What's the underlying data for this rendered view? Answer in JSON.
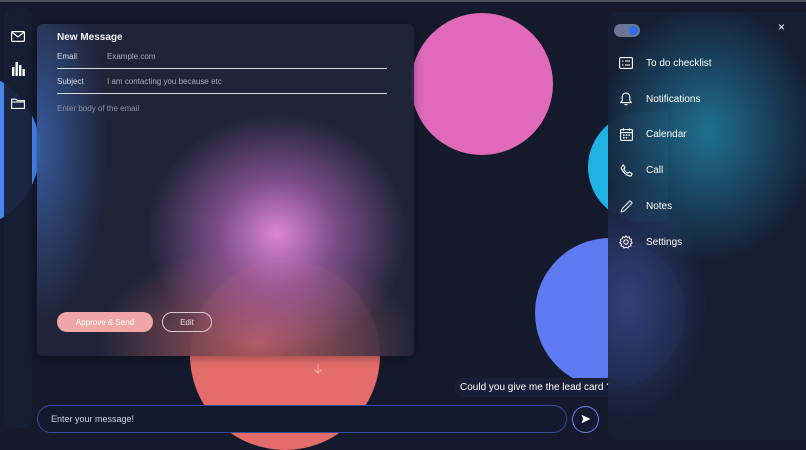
{
  "compose": {
    "title": "New Message",
    "email_label": "Email",
    "email_value": "Example.com",
    "subject_label": "Subject",
    "subject_value": "I am contacting you because etc",
    "body_placeholder": "Enter body of the email",
    "approve_label": "Approve & Send",
    "edit_label": "Edit"
  },
  "rail": {
    "icons": [
      "mail-icon",
      "bar-chart-icon",
      "folder-icon"
    ]
  },
  "chat": {
    "message": "Could you give me the lead card ?",
    "input_placeholder": "Enter your message!"
  },
  "panel": {
    "close_label": "×",
    "items": [
      {
        "label": "To do checklist",
        "icon": "checklist-icon"
      },
      {
        "label": "Notifications",
        "icon": "bell-icon"
      },
      {
        "label": "Calendar",
        "icon": "calendar-icon"
      },
      {
        "label": "Call",
        "icon": "phone-icon"
      },
      {
        "label": "Notes",
        "icon": "pencil-icon"
      },
      {
        "label": "Settings",
        "icon": "gear-icon"
      }
    ]
  },
  "colors": {
    "background": "#141a2c",
    "accent_pink": "#e06ab8",
    "accent_blue": "#4a86f0",
    "accent_cyan": "#1fb2e2",
    "accent_violet": "#5f7af0",
    "accent_coral": "#e46d6b",
    "approve_button": "#f0a6a6",
    "toggle_knob": "#2d6df0"
  }
}
